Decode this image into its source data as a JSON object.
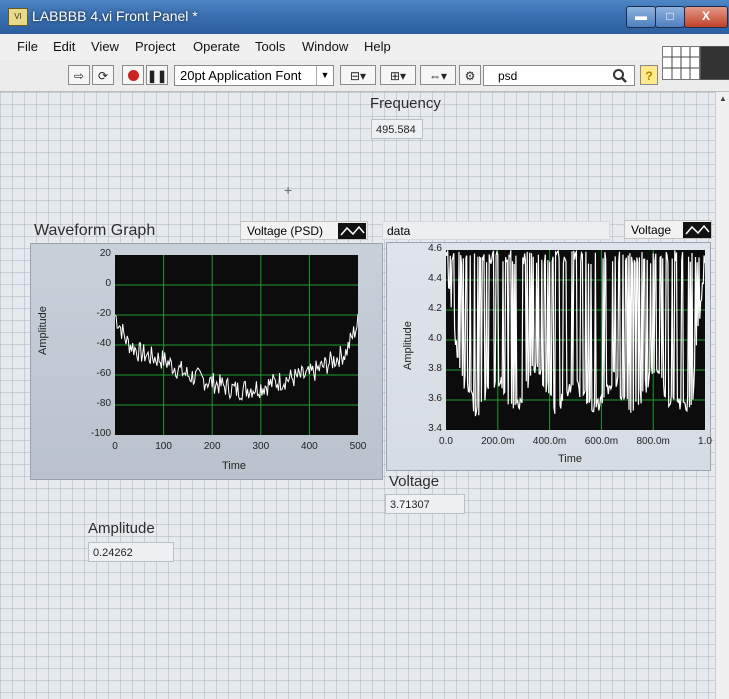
{
  "window": {
    "title": "LABBBB 4.vi Front Panel *",
    "icon": "labview-vi-icon",
    "controls": {
      "minimize": "▬",
      "maximize": "□",
      "close": "X"
    }
  },
  "menu": [
    "File",
    "Edit",
    "View",
    "Project",
    "Operate",
    "Tools",
    "Window",
    "Help"
  ],
  "toolbar": {
    "font": "20pt Application Font",
    "search": "psd",
    "help": "?"
  },
  "frequency": {
    "label": "Frequency",
    "value": "495.584"
  },
  "graph1": {
    "label": "Waveform Graph",
    "legend": "Voltage (PSD)",
    "x_title": "Time",
    "y_title": "Amplitude",
    "x_ticks": [
      "0",
      "100",
      "200",
      "300",
      "400",
      "500"
    ],
    "y_ticks": [
      "20",
      "0",
      "-20",
      "-40",
      "-60",
      "-80",
      "-100"
    ]
  },
  "graph2": {
    "label": "data",
    "legend": "Voltage",
    "x_title": "Time",
    "y_title": "Amplitude",
    "x_ticks": [
      "0.0",
      "200.0m",
      "400.0m",
      "600.0m",
      "800.0m",
      "1.0"
    ],
    "y_ticks": [
      "4.6",
      "4.4",
      "4.2",
      "4.0",
      "3.8",
      "3.6",
      "3.4"
    ]
  },
  "voltage": {
    "label": "Voltage",
    "value": "3.71307"
  },
  "amplitude": {
    "label": "Amplitude",
    "value": "0.24262"
  },
  "colors": {
    "plot_bg": "#0c0c0c",
    "plot_grid": "#1f9b2e",
    "trace": "#ffffff",
    "title_bar": "#3a6fb0"
  },
  "chart_data": [
    {
      "type": "line",
      "title": "Waveform Graph",
      "series": [
        {
          "name": "Voltage (PSD)",
          "x": [
            0,
            25,
            50,
            75,
            100,
            150,
            200,
            250,
            300,
            350,
            400,
            450,
            475,
            500
          ],
          "y": [
            -20,
            -38,
            -45,
            -48,
            -50,
            -60,
            -65,
            -70,
            -68,
            -63,
            -60,
            -50,
            -45,
            -25
          ]
        }
      ],
      "xlabel": "Time",
      "ylabel": "Amplitude",
      "xlim": [
        0,
        500
      ],
      "ylim": [
        -100,
        20
      ],
      "grid": true
    },
    {
      "type": "line",
      "title": "data",
      "series": [
        {
          "name": "Voltage",
          "x": [
            0.0,
            0.05,
            0.12,
            0.2,
            0.27,
            0.34,
            0.42,
            0.5,
            0.58,
            0.65,
            0.72,
            0.8,
            0.88,
            0.95,
            1.0
          ],
          "y": [
            4.55,
            3.8,
            3.52,
            3.75,
            3.52,
            3.85,
            3.55,
            3.7,
            3.55,
            3.75,
            3.52,
            3.8,
            3.55,
            3.6,
            4.55
          ]
        }
      ],
      "xlabel": "Time",
      "ylabel": "Amplitude",
      "xlim": [
        0,
        1.0
      ],
      "ylim": [
        3.4,
        4.6
      ],
      "grid": true
    }
  ]
}
